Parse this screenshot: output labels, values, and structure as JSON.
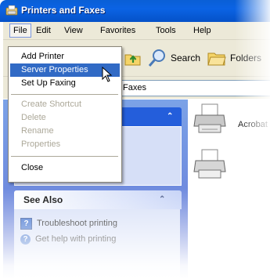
{
  "window": {
    "title": "Printers and Faxes"
  },
  "menubar": {
    "items": [
      {
        "label": "File"
      },
      {
        "label": "Edit"
      },
      {
        "label": "View"
      },
      {
        "label": "Favorites"
      },
      {
        "label": "Tools"
      },
      {
        "label": "Help"
      }
    ]
  },
  "toolbar": {
    "search_label": "Search",
    "folders_label": "Folders"
  },
  "address": {
    "value": "Faxes"
  },
  "file_menu": {
    "items": [
      {
        "label": "Add Printer",
        "state": "normal"
      },
      {
        "label": "Server Properties",
        "state": "highlighted"
      },
      {
        "label": "Set Up Faxing",
        "state": "normal"
      },
      {
        "label": "Create Shortcut",
        "state": "disabled"
      },
      {
        "label": "Delete",
        "state": "disabled"
      },
      {
        "label": "Rename",
        "state": "disabled"
      },
      {
        "label": "Properties",
        "state": "disabled"
      },
      {
        "label": "Close",
        "state": "normal"
      }
    ]
  },
  "see_also": {
    "title": "See Also",
    "items": [
      {
        "label": "Troubleshoot printing",
        "icon": "help-page-icon"
      },
      {
        "label": "Get help with printing",
        "icon": "help-circle-icon"
      }
    ]
  },
  "printers": [
    {
      "label": "Acrobat"
    }
  ],
  "colors": {
    "titlebar": "#0b63e4",
    "menu_highlight": "#316ac5",
    "taskpane": "#6375d6",
    "chrome": "#ece9d8"
  }
}
